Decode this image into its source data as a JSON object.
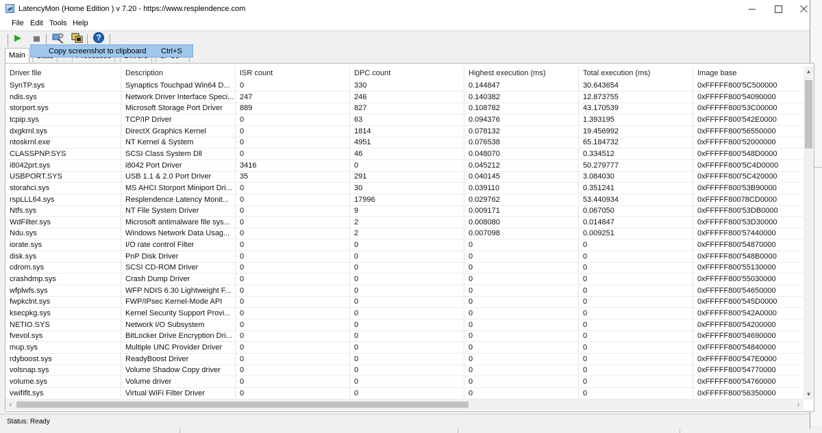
{
  "window": {
    "title": "LatencyMon  (Home Edition )  v 7.20 - https://www.resplendence.com"
  },
  "menu": [
    "File",
    "Edit",
    "Tools",
    "Help"
  ],
  "tabs": {
    "main": "Main",
    "stats_partial": "Stats",
    "processes_partial": "Processes",
    "drivers_partial": "Drivers",
    "cpus_partial": "CPUs"
  },
  "tooltip": {
    "label": "Copy screenshot to clipboard",
    "shortcut": "Ctrl+S"
  },
  "table": {
    "columns": [
      "Driver file",
      "Description",
      "ISR count",
      "DPC count",
      "Highest execution (ms)",
      "Total execution (ms)",
      "Image base"
    ],
    "rows": [
      [
        "SynTP.sys",
        "Synaptics Touchpad Win64 D...",
        "0",
        "330",
        "0.144847",
        "30.643654",
        "0xFFFFF800'5C500000"
      ],
      [
        "ndis.sys",
        "Network Driver Interface Speci...",
        "247",
        "246",
        "0.140382",
        "12.873755",
        "0xFFFFF800'54090000"
      ],
      [
        "storport.sys",
        "Microsoft Storage Port Driver",
        "889",
        "827",
        "0.108782",
        "43.170539",
        "0xFFFFF800'53C00000"
      ],
      [
        "tcpip.sys",
        "TCP/IP Driver",
        "0",
        "63",
        "0.094376",
        "1.393195",
        "0xFFFFF800'542E0000"
      ],
      [
        "dxgkrnl.sys",
        "DirectX Graphics Kernel",
        "0",
        "1814",
        "0.078132",
        "19.456992",
        "0xFFFFF800'56550000"
      ],
      [
        "ntoskrnl.exe",
        "NT Kernel & System",
        "0",
        "4951",
        "0.076538",
        "65.184732",
        "0xFFFFF800'52000000"
      ],
      [
        "CLASSPNP.SYS",
        "SCSI Class System Dll",
        "0",
        "46",
        "0.048070",
        "0.334512",
        "0xFFFFF800'548D0000"
      ],
      [
        "i8042prt.sys",
        "i8042 Port Driver",
        "3416",
        "0",
        "0.045212",
        "50.279777",
        "0xFFFFF800'5C4D0000"
      ],
      [
        "USBPORT.SYS",
        "USB 1.1 & 2.0 Port Driver",
        "35",
        "291",
        "0.040145",
        "3.084030",
        "0xFFFFF800'5C420000"
      ],
      [
        "storahci.sys",
        "MS AHCI Storport Miniport Dri...",
        "0",
        "30",
        "0.039110",
        "0.351241",
        "0xFFFFF800'53B90000"
      ],
      [
        "rspLLL64.sys",
        "Resplendence Latency Monit...",
        "0",
        "17996",
        "0.029762",
        "53.440934",
        "0xFFFFF80078CD0000"
      ],
      [
        "Ntfs.sys",
        "NT File System Driver",
        "0",
        "9",
        "0.009171",
        "0.067050",
        "0xFFFFF800'53DB0000"
      ],
      [
        "WdFilter.sys",
        "Microsoft antimalware file sys...",
        "0",
        "2",
        "0.008080",
        "0.014847",
        "0xFFFFF800'53D30000"
      ],
      [
        "Ndu.sys",
        "Windows Network Data Usag...",
        "0",
        "2",
        "0.007098",
        "0.009251",
        "0xFFFFF800'57440000"
      ],
      [
        "iorate.sys",
        "I/O rate control Filter",
        "0",
        "0",
        "0",
        "0",
        "0xFFFFF800'54870000"
      ],
      [
        "disk.sys",
        "PnP Disk Driver",
        "0",
        "0",
        "0",
        "0",
        "0xFFFFF800'548B0000"
      ],
      [
        "cdrom.sys",
        "SCSI CD-ROM Driver",
        "0",
        "0",
        "0",
        "0",
        "0xFFFFF800'55130000"
      ],
      [
        "crashdmp.sys",
        "Crash Dump Driver",
        "0",
        "0",
        "0",
        "0",
        "0xFFFFF800'55030000"
      ],
      [
        "wfplwfs.sys",
        "WFP NDIS 6.30 Lightweight F...",
        "0",
        "0",
        "0",
        "0",
        "0xFFFFF800'54650000"
      ],
      [
        "fwpkclnt.sys",
        "FWP/IPsec Kernel-Mode API",
        "0",
        "0",
        "0",
        "0",
        "0xFFFFF800'545D0000"
      ],
      [
        "ksecpkg.sys",
        "Kernel Security Support Provi...",
        "0",
        "0",
        "0",
        "0",
        "0xFFFFF800'542A0000"
      ],
      [
        "NETIO.SYS",
        "Network I/O Subsystem",
        "0",
        "0",
        "0",
        "0",
        "0xFFFFF800'54200000"
      ],
      [
        "fvevol.sys",
        "BitLocker Drive Encryption Dri...",
        "0",
        "0",
        "0",
        "0",
        "0xFFFFF800'54690000"
      ],
      [
        "mup.sys",
        "Multiple UNC Provider Driver",
        "0",
        "0",
        "0",
        "0",
        "0xFFFFF800'54840000"
      ],
      [
        "rdyboost.sys",
        "ReadyBoost Driver",
        "0",
        "0",
        "0",
        "0",
        "0xFFFFF800'547E0000"
      ],
      [
        "volsnap.sys",
        "Volume Shadow Copy driver",
        "0",
        "0",
        "0",
        "0",
        "0xFFFFF800'54770000"
      ],
      [
        "volume.sys",
        "Volume driver",
        "0",
        "0",
        "0",
        "0",
        "0xFFFFF800'54760000"
      ],
      [
        "vwififlt.sys",
        "Virtual WiFi Filter Driver",
        "0",
        "0",
        "0",
        "0",
        "0xFFFFF800'56350000"
      ]
    ]
  },
  "status": {
    "text": "Status: Ready"
  }
}
